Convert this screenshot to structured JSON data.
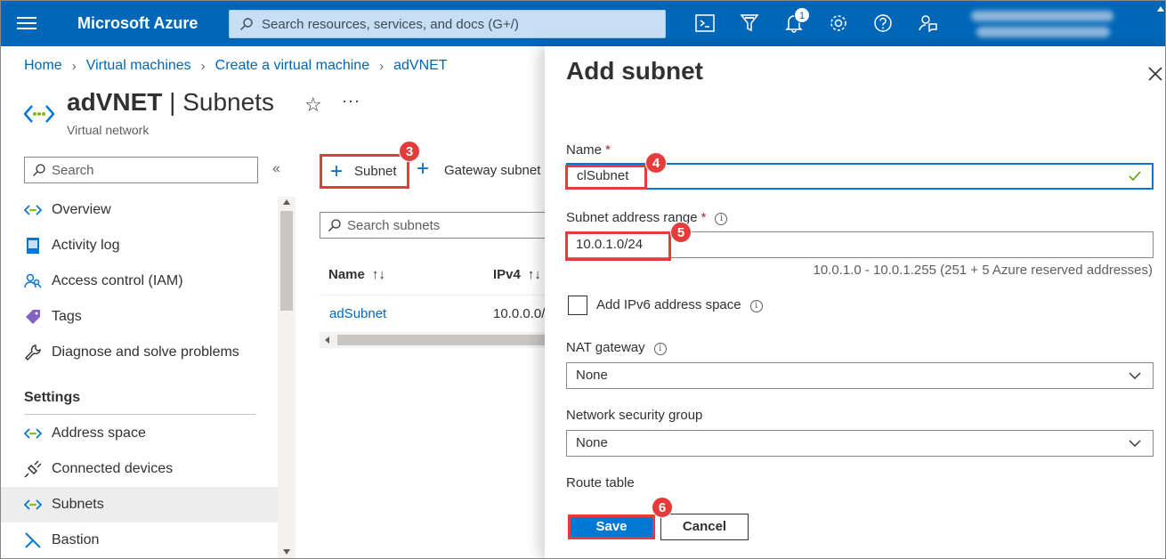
{
  "topbar": {
    "brand": "Microsoft Azure",
    "search_placeholder": "Search resources, services, and docs (G+/)",
    "notification_count": "1",
    "icons": [
      "cloud-shell-icon",
      "directory-filter-icon",
      "notifications-icon",
      "settings-icon",
      "help-icon",
      "feedback-icon"
    ]
  },
  "breadcrumb": [
    "Home",
    "Virtual machines",
    "Create a virtual machine",
    "adVNET"
  ],
  "header": {
    "resource_name": "adVNET",
    "separator": "|",
    "page": "Subnets",
    "subtitle": "Virtual network",
    "more": "···"
  },
  "nav": {
    "search_placeholder": "Search",
    "items": [
      {
        "label": "Overview",
        "icon": "vnet-icon"
      },
      {
        "label": "Activity log",
        "icon": "activity-log-icon"
      },
      {
        "label": "Access control (IAM)",
        "icon": "iam-icon"
      },
      {
        "label": "Tags",
        "icon": "tag-icon"
      },
      {
        "label": "Diagnose and solve problems",
        "icon": "wrench-icon"
      }
    ],
    "settings_header": "Settings",
    "settings_items": [
      {
        "label": "Address space",
        "icon": "vnet-icon"
      },
      {
        "label": "Connected devices",
        "icon": "plug-icon"
      },
      {
        "label": "Subnets",
        "icon": "vnet-icon",
        "active": true
      },
      {
        "label": "Bastion",
        "icon": "bastion-icon"
      }
    ]
  },
  "content": {
    "add_subnet_label": "Subnet",
    "gateway_subnet_label": "Gateway subnet",
    "search_placeholder": "Search subnets",
    "columns": [
      {
        "label": "Name",
        "sort": "↑↓"
      },
      {
        "label": "IPv4",
        "sort": "↑↓"
      }
    ],
    "rows": [
      {
        "name": "adSubnet",
        "ipv4": "10.0.0.0/"
      }
    ]
  },
  "panel": {
    "title": "Add subnet",
    "name_label": "Name",
    "name_value": "clSubnet",
    "range_label": "Subnet address range",
    "range_value": "10.0.1.0/24",
    "range_hint": "10.0.1.0 - 10.0.1.255 (251 + 5 Azure reserved addresses)",
    "ipv6_label": "Add IPv6 address space",
    "ipv6_checked": false,
    "nat_label": "NAT gateway",
    "nat_value": "None",
    "nsg_label": "Network security group",
    "nsg_value": "None",
    "route_label": "Route table",
    "required_marker": "*",
    "save_label": "Save",
    "cancel_label": "Cancel"
  },
  "annotations": {
    "step_add": "3",
    "step_name": "4",
    "step_range": "5",
    "step_save": "6",
    "highlight_color": "#e63b3b"
  },
  "colors": {
    "brand": "#0067b8",
    "accent": "#0078d4",
    "link": "#0067b8"
  }
}
